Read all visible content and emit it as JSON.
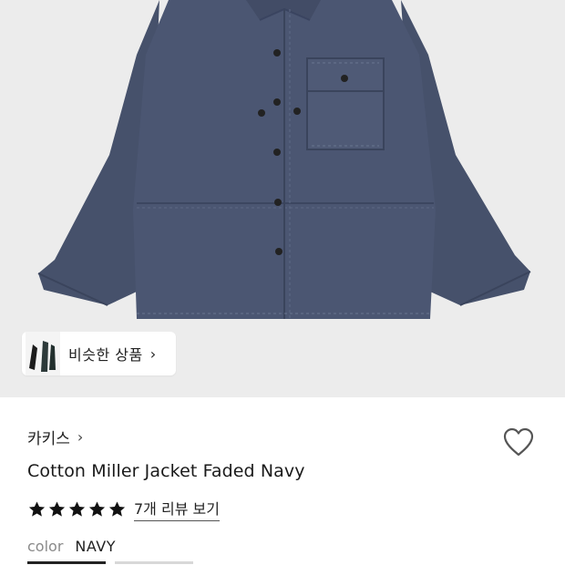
{
  "hero": {
    "image": "navy-cotton-jacket-photo",
    "background": "#ececec",
    "jacket_color": "#4a5570"
  },
  "similar_products": {
    "label": "비슷한 상품",
    "chevron": "chevron-right-icon"
  },
  "product": {
    "brand": "카키스",
    "brand_chevron": "chevron-right-icon",
    "title": "Cotton Miller Jacket Faded Navy",
    "rating_stars": 5,
    "review_link": "7개 리뷰 보기",
    "color_label": "color",
    "color_value": "NAVY",
    "wishlist_icon": "heart-icon"
  }
}
